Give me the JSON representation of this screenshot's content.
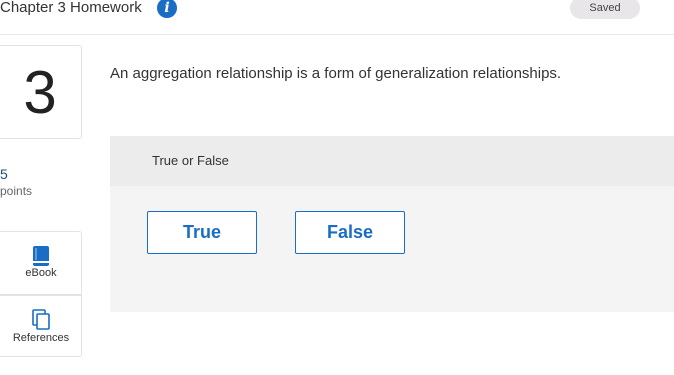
{
  "header": {
    "title": "Chapter 3 Homework",
    "info_icon": "info-icon",
    "status": "Saved"
  },
  "question": {
    "number": "3",
    "points_value": "5",
    "points_label": "points",
    "text": "An aggregation relationship is a form of generalization relationships.",
    "type_label": "True or False",
    "choices": [
      "True",
      "False"
    ]
  },
  "tools": {
    "ebook_label": "eBook",
    "ebook_icon": "book-icon",
    "references_label": "References",
    "references_icon": "documents-icon"
  },
  "colors": {
    "accent": "#1a6dc4",
    "panel_bg": "#f4f4f4",
    "panel_header_bg": "#ececec"
  }
}
